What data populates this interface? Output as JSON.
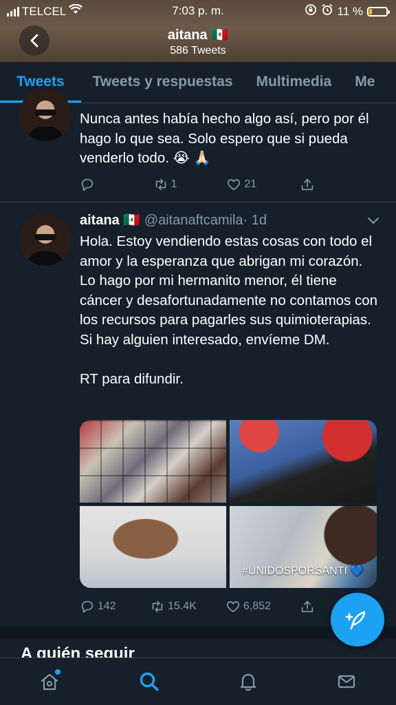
{
  "status_bar": {
    "carrier": "TELCEL",
    "time": "7:03 p. m.",
    "battery": "11 %"
  },
  "header": {
    "title": "aitana 🇲🇽",
    "subtitle": "586 Tweets"
  },
  "tabs": [
    {
      "label": "Tweets",
      "active": true
    },
    {
      "label": "Tweets y respuestas",
      "active": false
    },
    {
      "label": "Multimedia",
      "active": false
    },
    {
      "label": "Me",
      "active": false
    }
  ],
  "tweet1": {
    "text": "Nunca antes había hecho algo así, pero por él hago lo que sea. Solo espero que si pueda venderlo todo. 😭 🙏🏻",
    "replies": "",
    "retweets": "1",
    "likes": "21"
  },
  "tweet2": {
    "name": "aitana",
    "flag": "🇲🇽",
    "handle": "@aitanaftcamila",
    "time": "· 1d",
    "text": "Hola. Estoy vendiendo estas cosas con todo el amor y la esperanza que abrigan mi corazón. Lo hago por mi hermanito menor, él tiene cáncer y desafortunadamente no contamos con los recursos para pagarles sus quimioterapias. Si hay alguien interesado, envíeme DM.\n\nRT para difundir.",
    "media_caption": "#UNIDOSPORSANTI 💙",
    "replies": "142",
    "retweets": "15.4K",
    "likes": "6,852"
  },
  "section": {
    "who_to_follow": "A quién seguir"
  },
  "colors": {
    "background": "#15202b",
    "accent": "#1da1f2",
    "muted": "#8899a6",
    "border": "#38444d"
  },
  "icons": [
    "back-arrow-icon",
    "reply-icon",
    "retweet-icon",
    "like-icon",
    "share-icon",
    "chevron-down-icon",
    "compose-icon",
    "home-icon",
    "search-icon",
    "notifications-icon",
    "messages-icon"
  ]
}
